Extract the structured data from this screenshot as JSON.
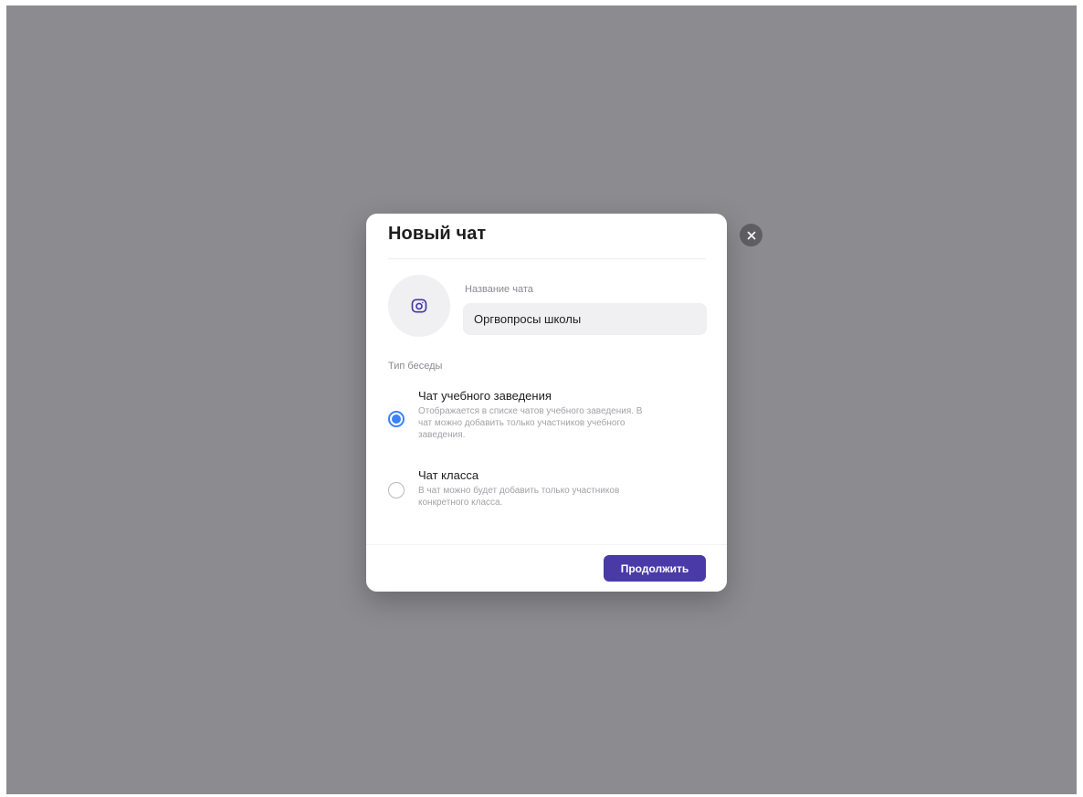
{
  "modal": {
    "title": "Новый чат",
    "avatar_icon": "camera-icon",
    "chat_name": {
      "label": "Название чата",
      "value": "Оргвопросы школы"
    },
    "type_section_label": "Тип беседы",
    "options": [
      {
        "title": "Чат учебного заведения",
        "description": "Отображается в списке чатов учебного заведения. В чат можно добавить только участников учебного заведения.",
        "selected": true
      },
      {
        "title": "Чат класса",
        "description": "В чат можно будет добавить только участников конкретного класса.",
        "selected": false
      }
    ],
    "continue_label": "Продолжить",
    "close_icon": "close-icon"
  },
  "colors": {
    "overlay": "#8c8c90",
    "accent_button": "#4a3aa8",
    "radio_selected": "#3b82f6",
    "icon_accent": "#4338a0"
  }
}
